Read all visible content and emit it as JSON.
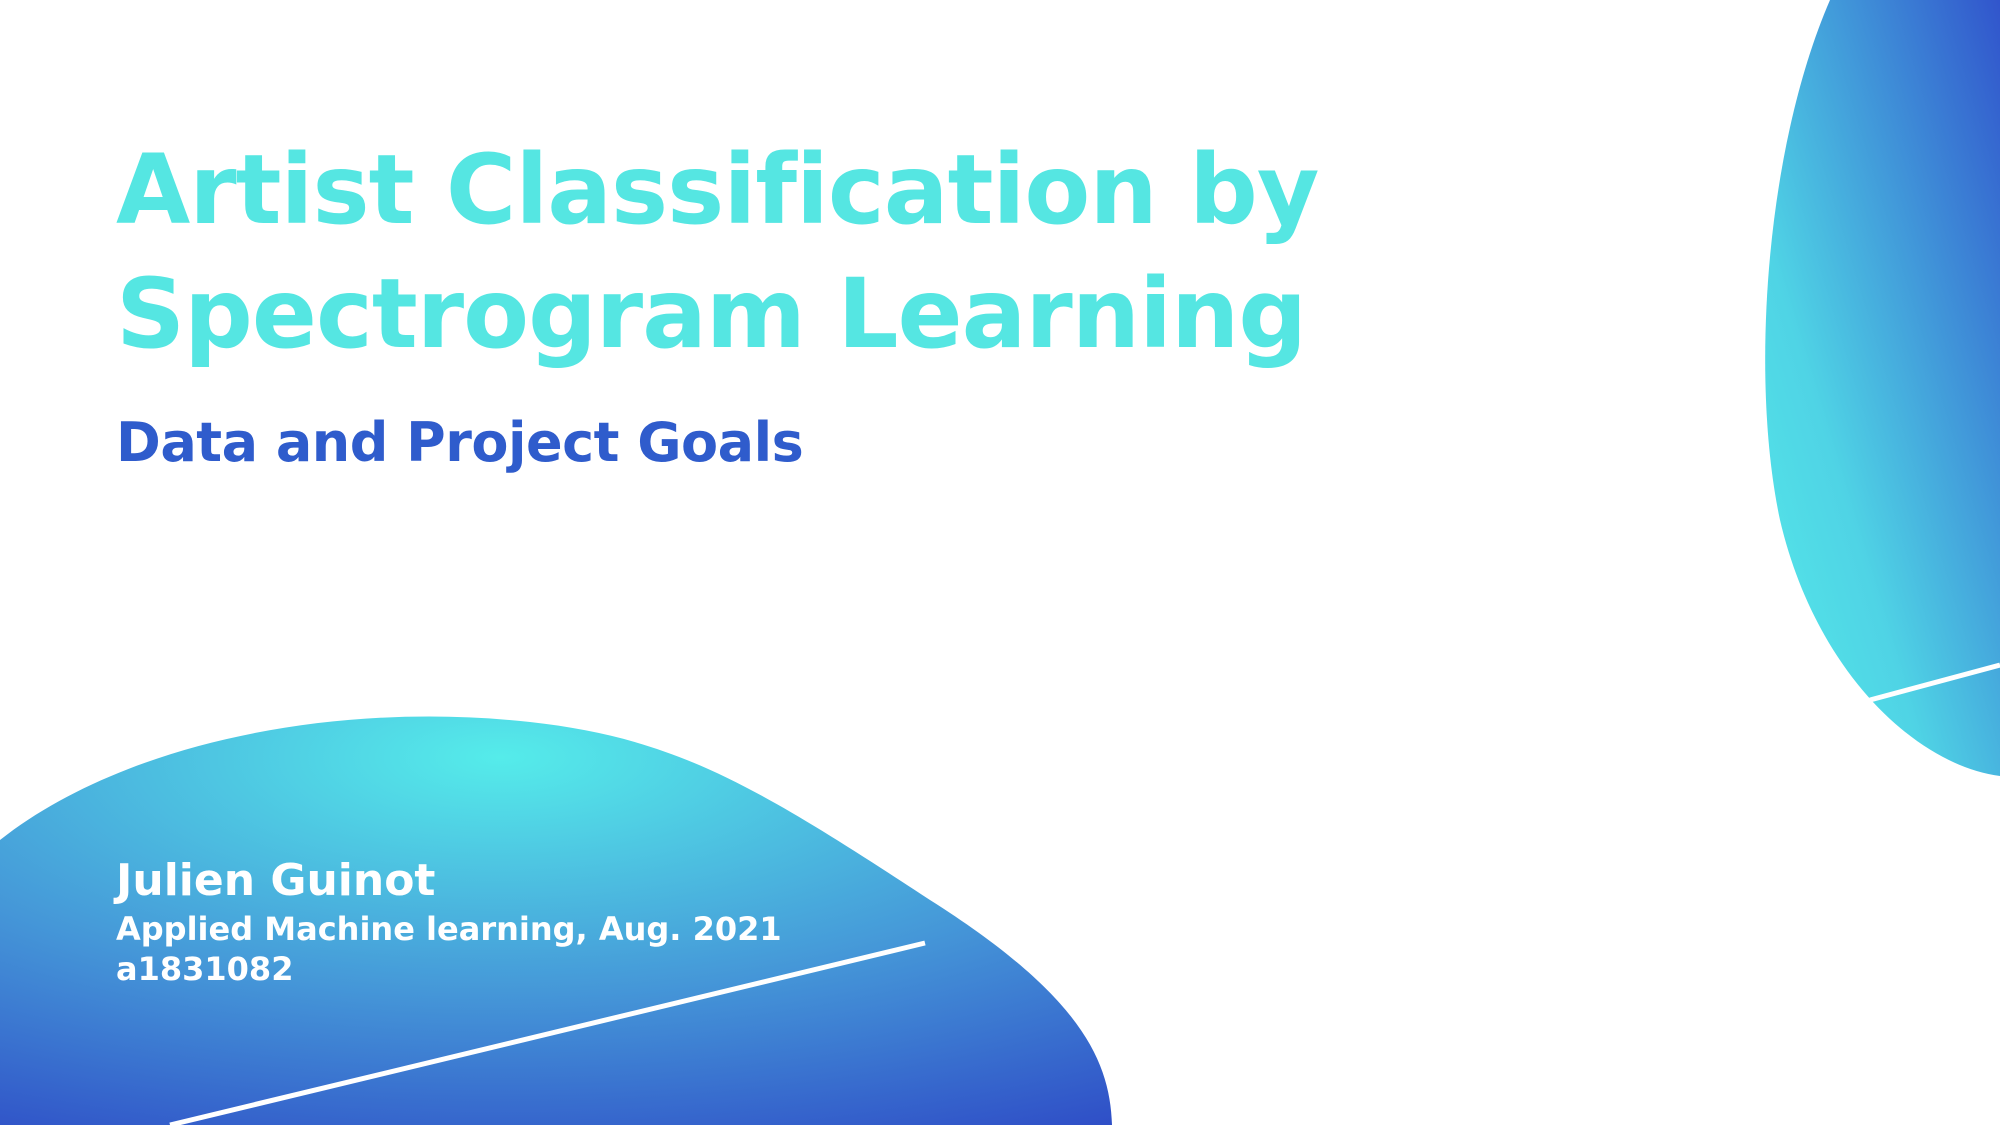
{
  "slide": {
    "title_line_1": "Artist Classification by",
    "title_line_2": "Spectrogram Learning",
    "subtitle": "Data and Project Goals",
    "author": "Julien Guinot",
    "course": "Applied Machine learning, Aug. 2021",
    "student_id": "a1831082"
  },
  "colors": {
    "title": "#55e6e2",
    "subtitle": "#2f5ccc",
    "gradient_light": "#55e6e2",
    "gradient_dark": "#2f4fc7",
    "author_text": "#ffffff"
  },
  "icons": {
    "bottom_blob": "wave-shape",
    "top_right_blob": "ellipse-shape"
  }
}
